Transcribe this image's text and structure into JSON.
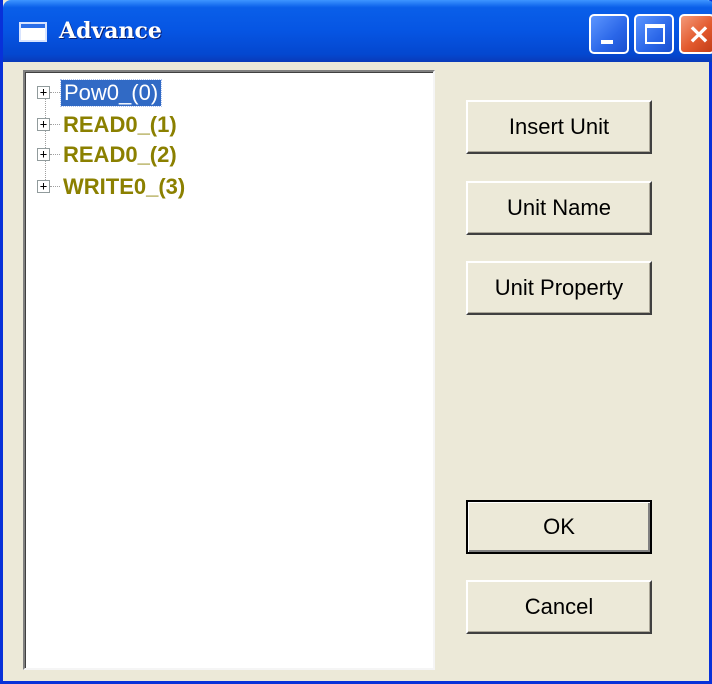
{
  "window": {
    "title": "Advance"
  },
  "tree": {
    "nodes": [
      {
        "label": "Pow0_(0)",
        "selected": true,
        "expander": "+"
      },
      {
        "label": "READ0_(1)",
        "selected": false,
        "expander": "+"
      },
      {
        "label": "READ0_(2)",
        "selected": false,
        "expander": "+"
      },
      {
        "label": "WRITE0_(3)",
        "selected": false,
        "expander": "+"
      }
    ]
  },
  "buttons": {
    "insert_unit": "Insert Unit",
    "unit_name": "Unit Name",
    "unit_property": "Unit Property",
    "ok": "OK",
    "cancel": "Cancel"
  },
  "colors": {
    "titlebar": "#0655e3",
    "dialog_bg": "#ece9d8",
    "node_text": "#8b8000",
    "selection": "#316ac5",
    "close_button": "#e35a2e"
  },
  "icons": {
    "window": "window-icon",
    "minimize": "minimize-icon",
    "maximize": "maximize-icon",
    "close": "close-icon",
    "expander": "plus-box-icon"
  }
}
